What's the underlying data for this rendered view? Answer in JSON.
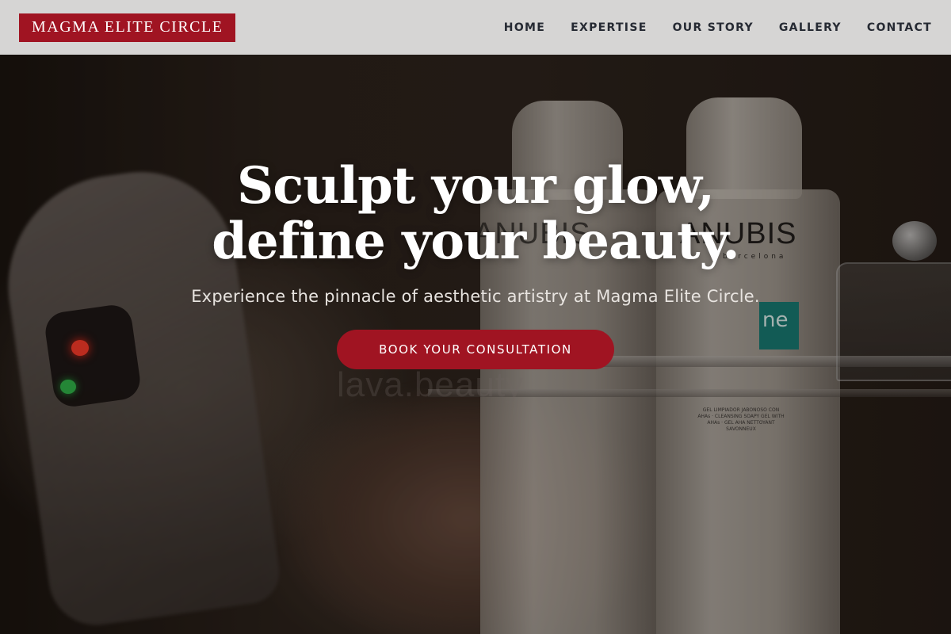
{
  "header": {
    "logo": "MAGMA ELITE CIRCLE",
    "nav": [
      {
        "label": "HOME"
      },
      {
        "label": "EXPERTISE"
      },
      {
        "label": "OUR STORY"
      },
      {
        "label": "GALLERY"
      },
      {
        "label": "CONTACT"
      }
    ]
  },
  "hero": {
    "title_line1": "Sculpt your glow,",
    "title_line2": "define your beauty.",
    "subtitle": "Experience the pinnacle of aesthetic artistry at Magma Elite Circle.",
    "cta_label": "BOOK YOUR CONSULTATION",
    "image": {
      "watermark": "lava.beauty",
      "bottle_brand": "ANUBIS",
      "bottle_brand_sub": "barcelona",
      "bottle_tag": "ne",
      "bottle_small_print": "GEL LIMPIADOR JABONOSO CON AHAs · CLEANSING SOAPY GEL WITH AHAs · GEL AHA NETTOYANT SAVONNEUX"
    }
  },
  "colors": {
    "brand": "#a01422",
    "header_bg": "#d6d5d4",
    "nav_text": "#262a33"
  }
}
